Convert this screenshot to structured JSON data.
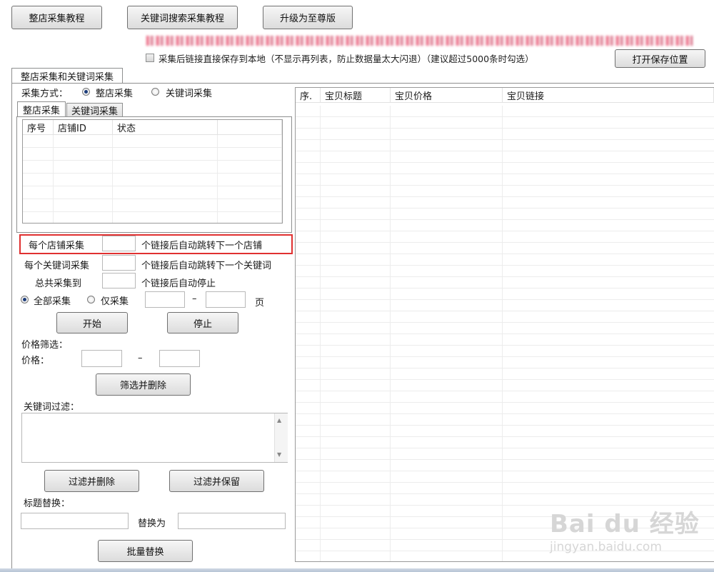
{
  "toolbar": {
    "btn_shop_tutorial": "整店采集教程",
    "btn_keyword_tutorial": "关键词搜索采集教程",
    "btn_upgrade": "升级为至尊版"
  },
  "options": {
    "save_checkbox_label": "采集后链接直接保存到本地（不显示再列表，防止数据量太大闪退）（建议超过5000条时勾选）",
    "btn_open_folder": "打开保存位置"
  },
  "main_tab": "整店采集和关键词采集",
  "collect_mode": {
    "label": "采集方式：",
    "opt_shop": "整店采集",
    "opt_keyword": "关键词采集"
  },
  "sub_tabs": {
    "shop": "整店采集",
    "keyword": "关键词采集"
  },
  "shop_table": {
    "headers": [
      "序号",
      "店铺ID",
      "状态",
      ""
    ]
  },
  "limits": {
    "per_shop_label": "每个店铺采集",
    "per_shop_suffix": "个链接后自动跳转下一个店铺",
    "per_keyword_label": "每个关键词采集",
    "per_keyword_suffix": "个链接后自动跳转下一个关键词",
    "total_label": "总共采集到",
    "total_suffix": "个链接后自动停止"
  },
  "range": {
    "opt_all": "全部采集",
    "opt_only": "仅采集",
    "dash": "–",
    "unit": "页"
  },
  "actions": {
    "start": "开始",
    "stop": "停止"
  },
  "price_filter": {
    "title": "价格筛选：",
    "label": "价格：",
    "dash": "–",
    "btn_filter_delete": "筛选并删除"
  },
  "keyword_filter": {
    "title": "关键词过滤：",
    "btn_filter_delete": "过滤并删除",
    "btn_filter_keep": "过滤并保留"
  },
  "title_replace": {
    "title": "标题替换：",
    "replace_with": "替换为",
    "btn_batch": "批量替换"
  },
  "results_table": {
    "headers": [
      "序.",
      "宝贝标题",
      "宝贝价格",
      "宝贝链接"
    ]
  },
  "watermark": {
    "brand": "Bai du 经验",
    "url": "jingyan.baidu.com"
  },
  "colors": {
    "highlight": "#e03030",
    "button_border": "#707070"
  }
}
